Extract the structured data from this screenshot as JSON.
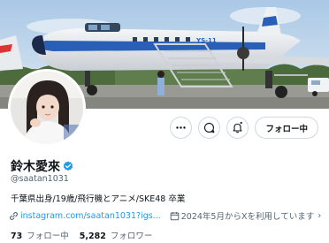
{
  "profile": {
    "name": "鈴木愛來",
    "handle": "@saatan1031",
    "bio": "千葉県出身/19歳/飛行機とアニメ/SKE48 卒業",
    "website": "instagram.com/saatan1031?igs...",
    "joined_note": "2024年5月からXを利用しています",
    "verified_color": "#1d9bf0"
  },
  "actions": {
    "more_icon": "more-icon",
    "message_icon": "message-icon",
    "subscribe_icon": "notification-subscribe-icon",
    "follow_label": "フォロー中"
  },
  "stats": {
    "following_count": "73",
    "following_label": "フォロー中",
    "followers_count": "5,282",
    "followers_label": "フォロワー"
  },
  "banner": {
    "plane_text": "YS-11"
  },
  "colors": {
    "link": "#1d9bf0",
    "muted": "#536471",
    "text": "#0f1419"
  }
}
